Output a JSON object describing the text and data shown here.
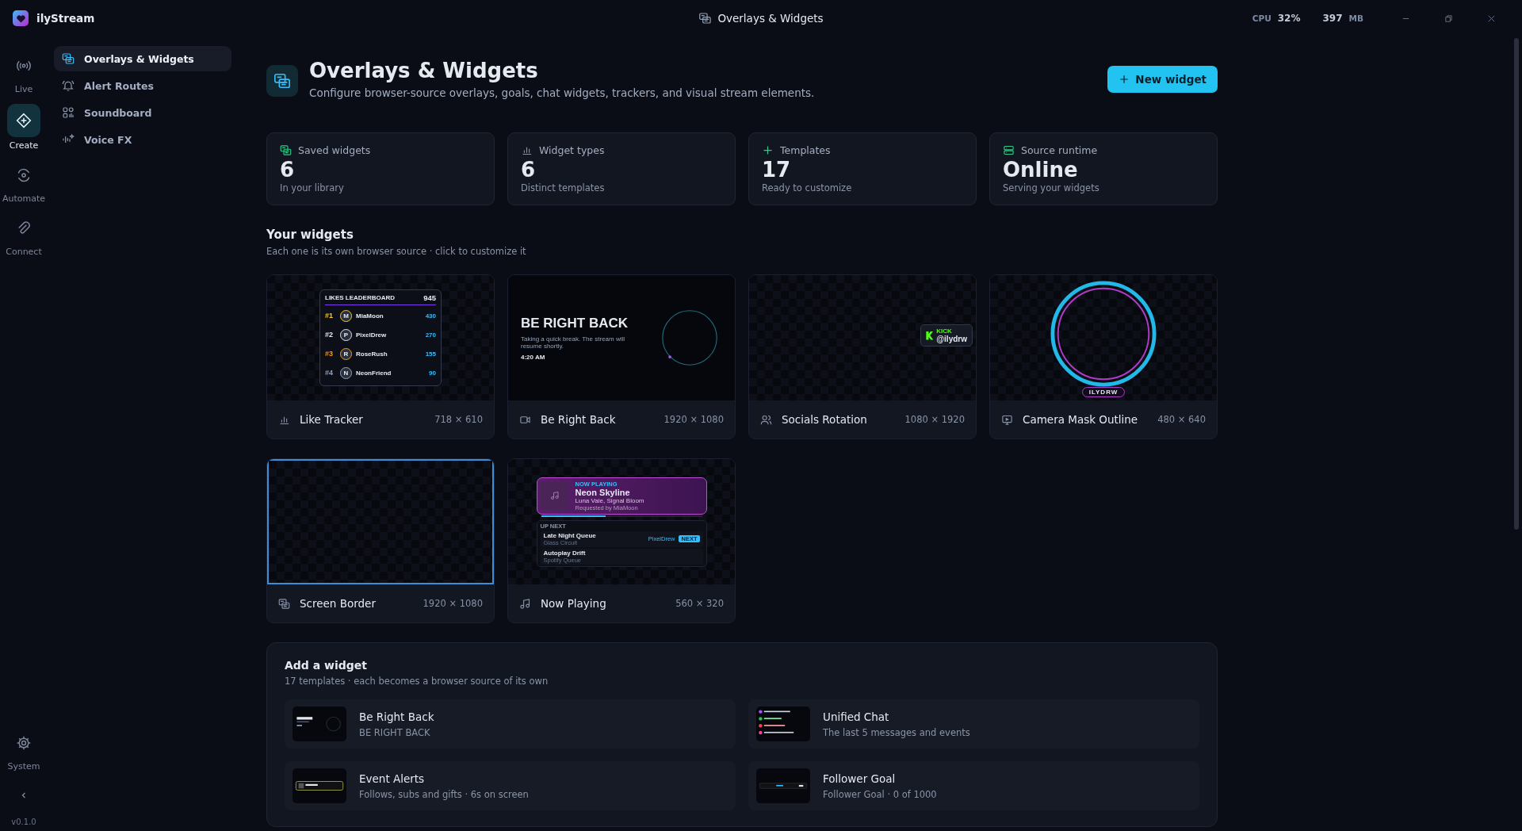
{
  "app": {
    "name": "ilyStream"
  },
  "titlebar": {
    "title": "Overlays & Widgets",
    "cpu_label": "CPU",
    "cpu_value": "32%",
    "mem_value": "397",
    "mem_unit": "MB"
  },
  "rail": {
    "items": [
      {
        "label": "Live",
        "selected": false
      },
      {
        "label": "Create",
        "selected": true
      },
      {
        "label": "Automate",
        "selected": false
      },
      {
        "label": "Connect",
        "selected": false
      }
    ],
    "system": "System",
    "version": "v0.1.0"
  },
  "nav": {
    "items": [
      {
        "label": "Overlays & Widgets",
        "selected": true
      },
      {
        "label": "Alert Routes",
        "selected": false
      },
      {
        "label": "Soundboard",
        "selected": false
      },
      {
        "label": "Voice FX",
        "selected": false
      }
    ]
  },
  "header": {
    "title": "Overlays & Widgets",
    "subtitle": "Configure browser-source overlays, goals, chat widgets, trackers, and visual stream elements.",
    "button": "New widget"
  },
  "stats": [
    {
      "label": "Saved widgets",
      "value": "6",
      "caption": "In your library"
    },
    {
      "label": "Widget types",
      "value": "6",
      "caption": "Distinct templates"
    },
    {
      "label": "Templates",
      "value": "17",
      "caption": "Ready to customize"
    },
    {
      "label": "Source runtime",
      "value": "Online",
      "caption": "Serving your widgets"
    }
  ],
  "widgets": {
    "title": "Your widgets",
    "subtitle": "Each one is its own browser source · click to customize it",
    "items": [
      {
        "kind": "leaderboard",
        "name": "Like Tracker",
        "size": "718 × 610",
        "preview": {
          "title": "LIKES LEADERBOARD",
          "total": "945",
          "rows": [
            {
              "rank": "#1",
              "initial": "M",
              "name": "MiaMoon",
              "value": "430",
              "color": "#facc15"
            },
            {
              "rank": "#2",
              "initial": "P",
              "name": "PixelDrew",
              "value": "270",
              "color": "#e2e8f0"
            },
            {
              "rank": "#3",
              "initial": "R",
              "name": "RoseRush",
              "value": "155",
              "color": "#f59e0b"
            },
            {
              "rank": "#4",
              "initial": "N",
              "name": "NeonFriend",
              "value": "90",
              "color": "#94a3b8"
            }
          ]
        }
      },
      {
        "kind": "brb",
        "name": "Be Right Back",
        "size": "1920 × 1080",
        "preview": {
          "headline": "BE RIGHT BACK",
          "message": "Taking a quick break. The stream will resume shortly.",
          "time": "4:20 AM"
        }
      },
      {
        "kind": "social",
        "name": "Socials Rotation",
        "size": "1080 × 1920",
        "preview": {
          "platform": "KICK",
          "handle": "@ilydrw"
        }
      },
      {
        "kind": "camera",
        "name": "Camera Mask Outline",
        "size": "480 × 640",
        "preview": {
          "tag": "ILYDRW"
        }
      },
      {
        "kind": "border",
        "name": "Screen Border",
        "size": "1920 × 1080"
      },
      {
        "kind": "nowplaying",
        "name": "Now Playing",
        "size": "560 × 320",
        "preview": {
          "label": "NOW PLAYING",
          "title": "Neon Skyline",
          "artist": "Luna Vale, Signal Bloom",
          "requested": "Requested by MiaMoon",
          "level": 0.4,
          "up_next": "UP NEXT",
          "queue": [
            {
              "title": "Late Night Queue",
              "subtitle": "Glass Circuit",
              "requester": "PixelDrew",
              "badge": "NEXT"
            },
            {
              "title": "Autoplay Drift",
              "subtitle": "Spotify Queue"
            }
          ]
        }
      }
    ]
  },
  "add": {
    "title": "Add a widget",
    "subtitle": "17 templates · each becomes a browser source of its own",
    "items": [
      {
        "kind": "brb",
        "name": "Be Right Back",
        "description": "BE RIGHT BACK"
      },
      {
        "kind": "chat",
        "name": "Unified Chat",
        "description": "The last 5 messages and events"
      },
      {
        "kind": "alert",
        "name": "Event Alerts",
        "description": "Follows, subs and gifts · 6s on screen"
      },
      {
        "kind": "goal",
        "name": "Follower Goal",
        "description": "Follower Goal · 0 of 1000"
      }
    ]
  }
}
